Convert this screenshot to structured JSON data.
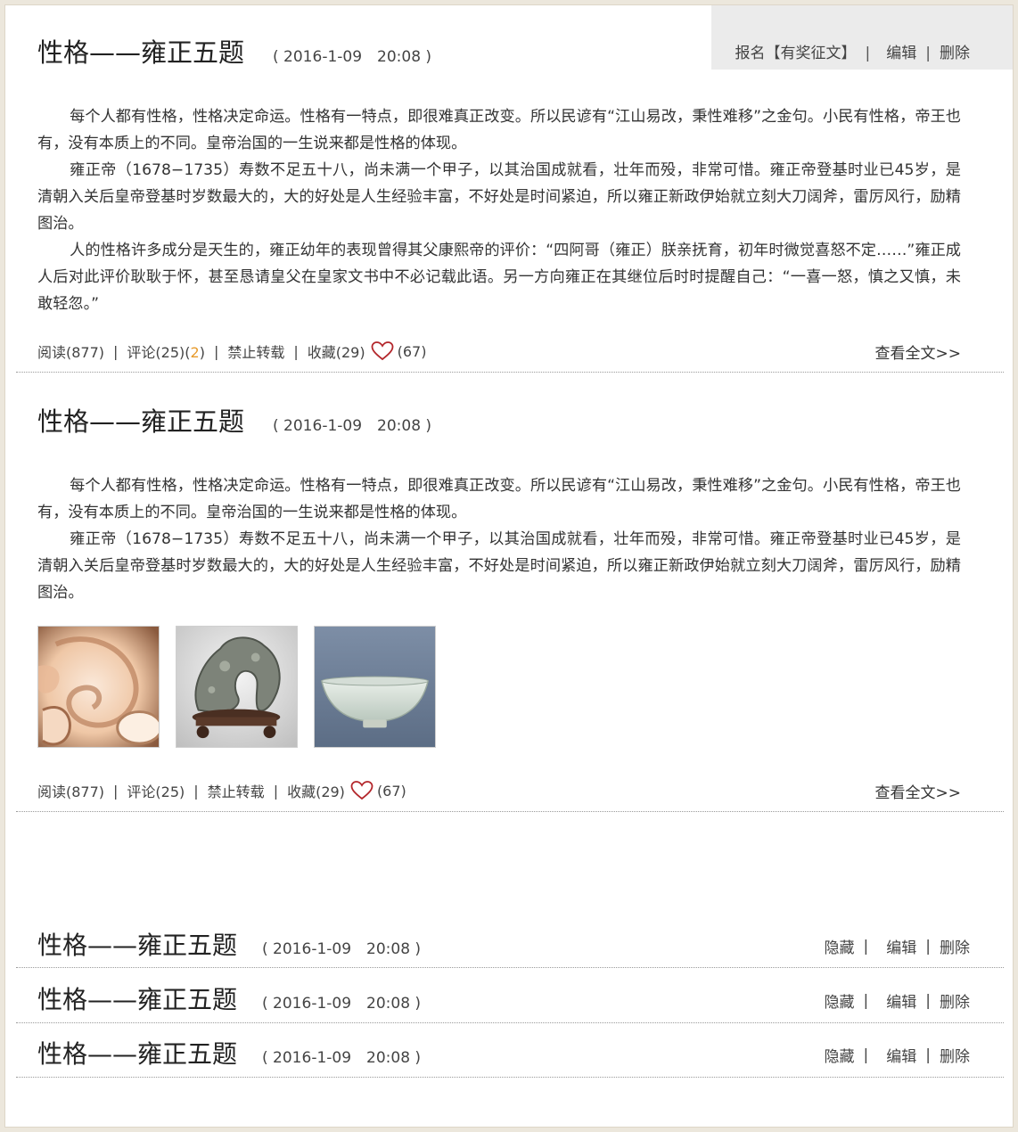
{
  "top_actions": {
    "signup": "报名【有奖征文】",
    "edit": "编辑",
    "delete": "删除"
  },
  "post1": {
    "title": "性格——雍正五题",
    "date": "( 2016-1-09　20:08 )",
    "paragraphs": [
      "每个人都有性格，性格决定命运。性格有一特点，即很难真正改变。所以民谚有“江山易改，秉性难移”之金句。小民有性格，帝王也有，没有本质上的不同。皇帝治国的一生说来都是性格的体现。",
      "雍正帝（1678−1735）寿数不足五十八，尚未满一个甲子，以其治国成就看，壮年而殁，非常可惜。雍正帝登基时业已45岁，是清朝入关后皇帝登基时岁数最大的，大的好处是人生经验丰富，不好处是时间紧迫，所以雍正新政伊始就立刻大刀阔斧，雷厉风行，励精图治。",
      "人的性格许多成分是天生的，雍正幼年的表现曾得其父康熙帝的评价：“四阿哥（雍正）朕亲抚育，初年时微觉喜怒不定……”雍正成人后对此评价耿耿于怀，甚至恳请皇父在皇家文书中不必记载此语。另一方向雍正在其继位后时时提醒自己：“一喜一怒，慎之又慎，未敢轻忽。”"
    ],
    "reads": "阅读(877)",
    "comments": "评论(25)(",
    "comments_new": "2",
    "comments_close": ")",
    "no_repost": "禁止转载",
    "favorites": "收藏(29)",
    "likes": "(67)",
    "read_more": "查看全文>>"
  },
  "post2": {
    "title": "性格——雍正五题",
    "date": "( 2016-1-09　20:08 )",
    "paragraphs": [
      "每个人都有性格，性格决定命运。性格有一特点，即很难真正改变。所以民谚有“江山易改，秉性难移”之金句。小民有性格，帝王也有，没有本质上的不同。皇帝治国的一生说来都是性格的体现。",
      "雍正帝（1678−1735）寿数不足五十八，尚未满一个甲子，以其治国成就看，壮年而殁，非常可惜。雍正帝登基时业已45岁，是清朝入关后皇帝登基时岁数最大的，大的好处是人生经验丰富，不好处是时间紧迫，所以雍正新政伊始就立刻大刀阔斧，雷厉风行，励精图治。"
    ],
    "reads": "阅读(877)",
    "comments": "评论(25)",
    "no_repost": "禁止转载",
    "favorites": "收藏(29)",
    "likes": "(67)",
    "read_more": "查看全文>>"
  },
  "compact_posts": [
    {
      "title": "性格——雍正五题",
      "date": "( 2016-1-09　20:08 )",
      "hide": "隐藏",
      "edit": "编辑",
      "delete": "删除"
    },
    {
      "title": "性格——雍正五题",
      "date": "( 2016-1-09　20:08 )",
      "hide": "隐藏",
      "edit": "编辑",
      "delete": "删除"
    },
    {
      "title": "性格——雍正五题",
      "date": "( 2016-1-09　20:08 )",
      "hide": "隐藏",
      "edit": "编辑",
      "delete": "删除"
    }
  ],
  "separator": "|",
  "colors": {
    "accent": "#e79a2b",
    "heart": "#b3262b",
    "panel": "#ebebeb"
  },
  "icons": {
    "like": "heart-icon"
  }
}
